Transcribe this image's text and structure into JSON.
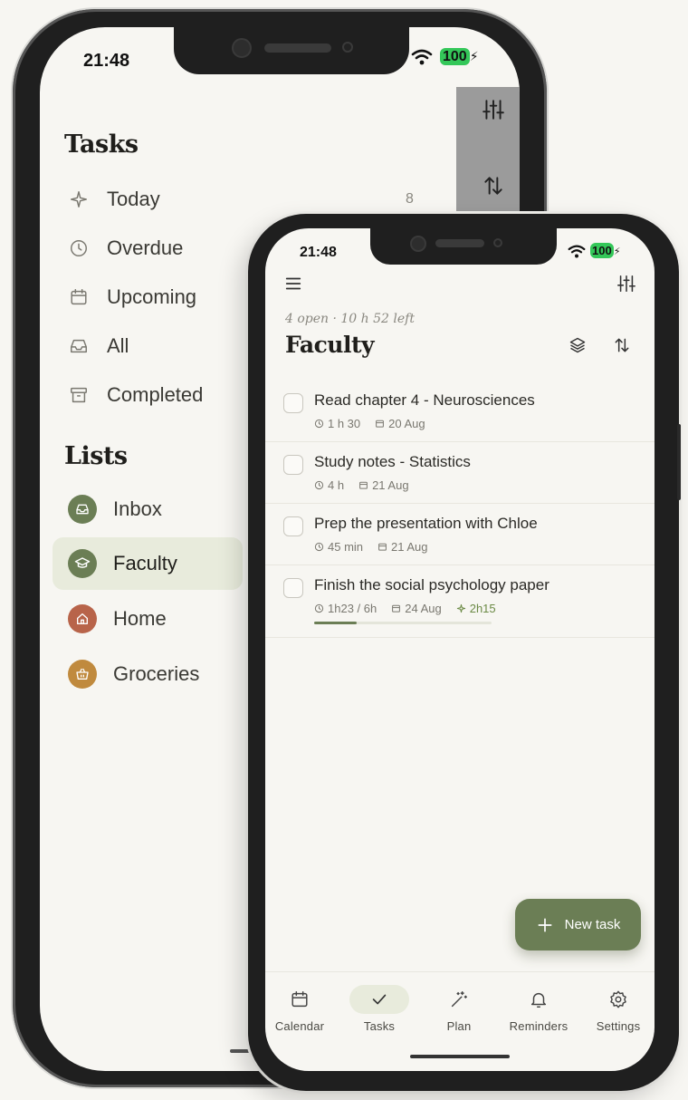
{
  "back_screen": {
    "status_time": "21:48",
    "battery": "100",
    "tasks_heading": "Tasks",
    "nav": [
      {
        "label": "Today",
        "count": "8",
        "icon": "sparkle-icon"
      },
      {
        "label": "Overdue",
        "count": "",
        "icon": "clock-icon"
      },
      {
        "label": "Upcoming",
        "count": "",
        "icon": "calendar-icon"
      },
      {
        "label": "All",
        "count": "",
        "icon": "inbox-tray-icon"
      },
      {
        "label": "Completed",
        "count": "",
        "icon": "archive-icon"
      }
    ],
    "lists_heading": "Lists",
    "lists": [
      {
        "label": "Inbox",
        "color": "#6b7e55",
        "icon": "inbox-icon"
      },
      {
        "label": "Faculty",
        "color": "#6b7e55",
        "icon": "graduation-cap-icon",
        "active": true
      },
      {
        "label": "Home",
        "color": "#b8644a",
        "icon": "house-icon"
      },
      {
        "label": "Groceries",
        "color": "#c08a3e",
        "icon": "basket-icon"
      }
    ]
  },
  "front_screen": {
    "status_time": "21:48",
    "battery": "100",
    "subtitle": "4 open · 10 h 52 left",
    "title": "Faculty",
    "tasks": [
      {
        "title": "Read chapter 4 - Neurosciences",
        "duration": "1 h 30",
        "date": "20 Aug"
      },
      {
        "title": "Study notes - Statistics",
        "duration": "4 h",
        "date": "21 Aug"
      },
      {
        "title": "Prep the presentation with Chloe",
        "duration": "45 min",
        "date": "21 Aug"
      },
      {
        "title": "Finish the social psychology paper",
        "duration": "1h23 / 6h",
        "date": "24 Aug",
        "extra": "2h15",
        "progress": 0.24
      }
    ],
    "fab_label": "New task",
    "tabs": [
      {
        "label": "Calendar",
        "icon": "calendar-icon"
      },
      {
        "label": "Tasks",
        "icon": "check-icon",
        "active": true
      },
      {
        "label": "Plan",
        "icon": "magic-wand-icon"
      },
      {
        "label": "Reminders",
        "icon": "bell-icon"
      },
      {
        "label": "Settings",
        "icon": "gear-icon"
      }
    ]
  },
  "colors": {
    "accent": "#6b7e55",
    "active_bg": "#e8ebdc",
    "background": "#f7f6f2"
  }
}
